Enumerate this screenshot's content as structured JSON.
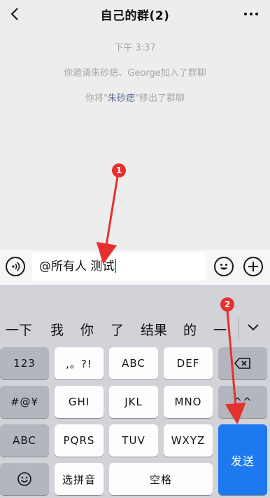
{
  "header": {
    "title": "自己的群(2)"
  },
  "chat": {
    "timestamp": "下午 3:37",
    "invite_msg": "你邀请朱砂痣、George加入了群聊",
    "remove_prefix": "你将\"",
    "remove_name": "朱砂痣",
    "remove_suffix": "\"移出了群聊"
  },
  "input": {
    "text": "@所有人 测试"
  },
  "candidates": [
    "一下",
    "我",
    "你",
    "了",
    "结果",
    "的",
    "一"
  ],
  "keyboard": {
    "row1": [
      "123",
      ",。?!",
      "ABC",
      "DEF"
    ],
    "row2": [
      "#@¥",
      "GHI",
      "JKL",
      "MNO",
      "^^"
    ],
    "row3": [
      "ABC",
      "PQRS",
      "TUV",
      "WXYZ"
    ],
    "pinyin": "选拼音",
    "space": "空格",
    "send": "发送"
  },
  "annotations": {
    "badge1": "1",
    "badge2": "2"
  },
  "colors": {
    "accent": "#1d79f0",
    "highlight_name": "#5a6c92",
    "annotation": "#e5312e",
    "caret": "#06b44a"
  },
  "icons": [
    "back-arrow-icon",
    "more-icon",
    "voice-icon",
    "emoji-icon",
    "plus-icon",
    "collapse-icon",
    "backspace-icon",
    "emoji-key-icon"
  ]
}
